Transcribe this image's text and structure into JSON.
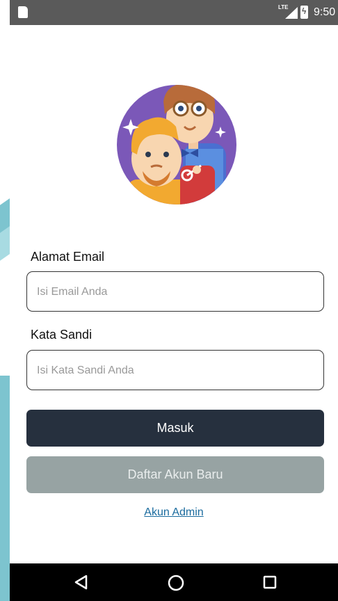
{
  "status_bar": {
    "network": "LTE",
    "time": "9:50",
    "icons": [
      "sd-card-icon",
      "signal-icon",
      "battery-charging-icon"
    ]
  },
  "form": {
    "email_label": "Alamat Email",
    "email_placeholder": "Isi Email Anda",
    "email_value": "",
    "password_label": "Kata Sandi",
    "password_placeholder": "Isi Kata Sandi Anda",
    "password_value": ""
  },
  "actions": {
    "login_label": "Masuk",
    "register_label": "Daftar Akun Baru",
    "admin_link_label": "Akun Admin"
  },
  "nav_bar": {
    "icons": [
      "back-icon",
      "home-icon",
      "recents-icon"
    ]
  },
  "colors": {
    "primary_button": "#26303e",
    "secondary_button": "#97a3a3",
    "link": "#1a6b9e",
    "status_bar": "#5a5a5a"
  }
}
